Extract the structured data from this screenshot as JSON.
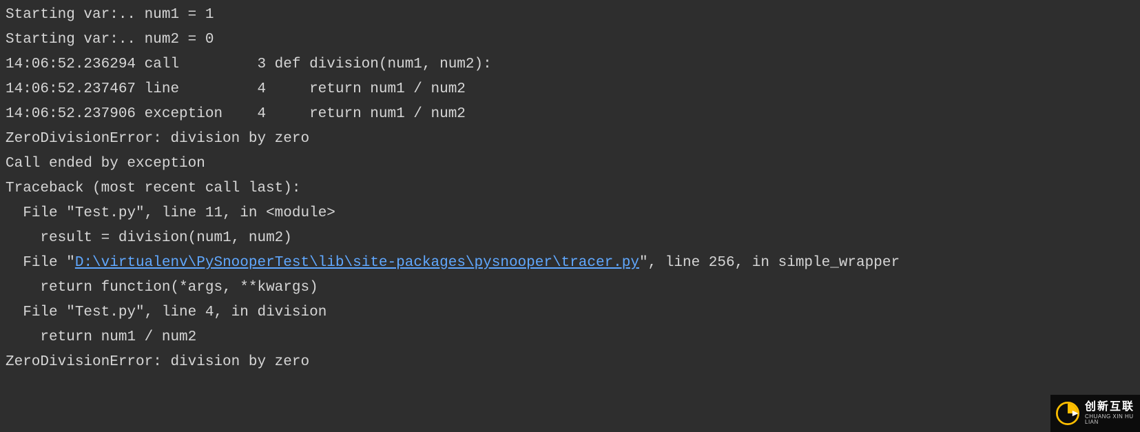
{
  "terminal": {
    "lines": [
      {
        "indent": "",
        "pre": "Starting var:.. num1 = 1",
        "link": "",
        "post": ""
      },
      {
        "indent": "",
        "pre": "Starting var:.. num2 = 0",
        "link": "",
        "post": ""
      },
      {
        "indent": "",
        "pre": "14:06:52.236294 call         3 def division(num1, num2):",
        "link": "",
        "post": ""
      },
      {
        "indent": "",
        "pre": "14:06:52.237467 line         4     return num1 / num2",
        "link": "",
        "post": ""
      },
      {
        "indent": "",
        "pre": "14:06:52.237906 exception    4     return num1 / num2",
        "link": "",
        "post": ""
      },
      {
        "indent": "",
        "pre": "ZeroDivisionError: division by zero",
        "link": "",
        "post": ""
      },
      {
        "indent": "",
        "pre": "Call ended by exception",
        "link": "",
        "post": ""
      },
      {
        "indent": "",
        "pre": "Traceback (most recent call last):",
        "link": "",
        "post": ""
      },
      {
        "indent": "  ",
        "pre": "File \"Test.py\", line 11, in <module>",
        "link": "",
        "post": ""
      },
      {
        "indent": "    ",
        "pre": "result = division(num1, num2)",
        "link": "",
        "post": ""
      },
      {
        "indent": "  ",
        "pre": "File \"",
        "link": "D:\\virtualenv\\PySnooperTest\\lib\\site-packages\\pysnooper\\tracer.py",
        "post": "\", line 256, in simple_wrapper"
      },
      {
        "indent": "    ",
        "pre": "return function(*args, **kwargs)",
        "link": "",
        "post": ""
      },
      {
        "indent": "  ",
        "pre": "File \"Test.py\", line 4, in division",
        "link": "",
        "post": ""
      },
      {
        "indent": "    ",
        "pre": "return num1 / num2",
        "link": "",
        "post": ""
      },
      {
        "indent": "",
        "pre": "ZeroDivisionError: division by zero",
        "link": "",
        "post": ""
      }
    ]
  },
  "watermark": {
    "cn": "创新互联",
    "py": "CHUANG XIN HU LIAN"
  },
  "colors": {
    "background": "#2e2e2e",
    "text": "#d6d6d6",
    "link": "#60a8ff",
    "watermark_bg": "#0c0c0c",
    "logo_accent": "#ffbf00"
  }
}
